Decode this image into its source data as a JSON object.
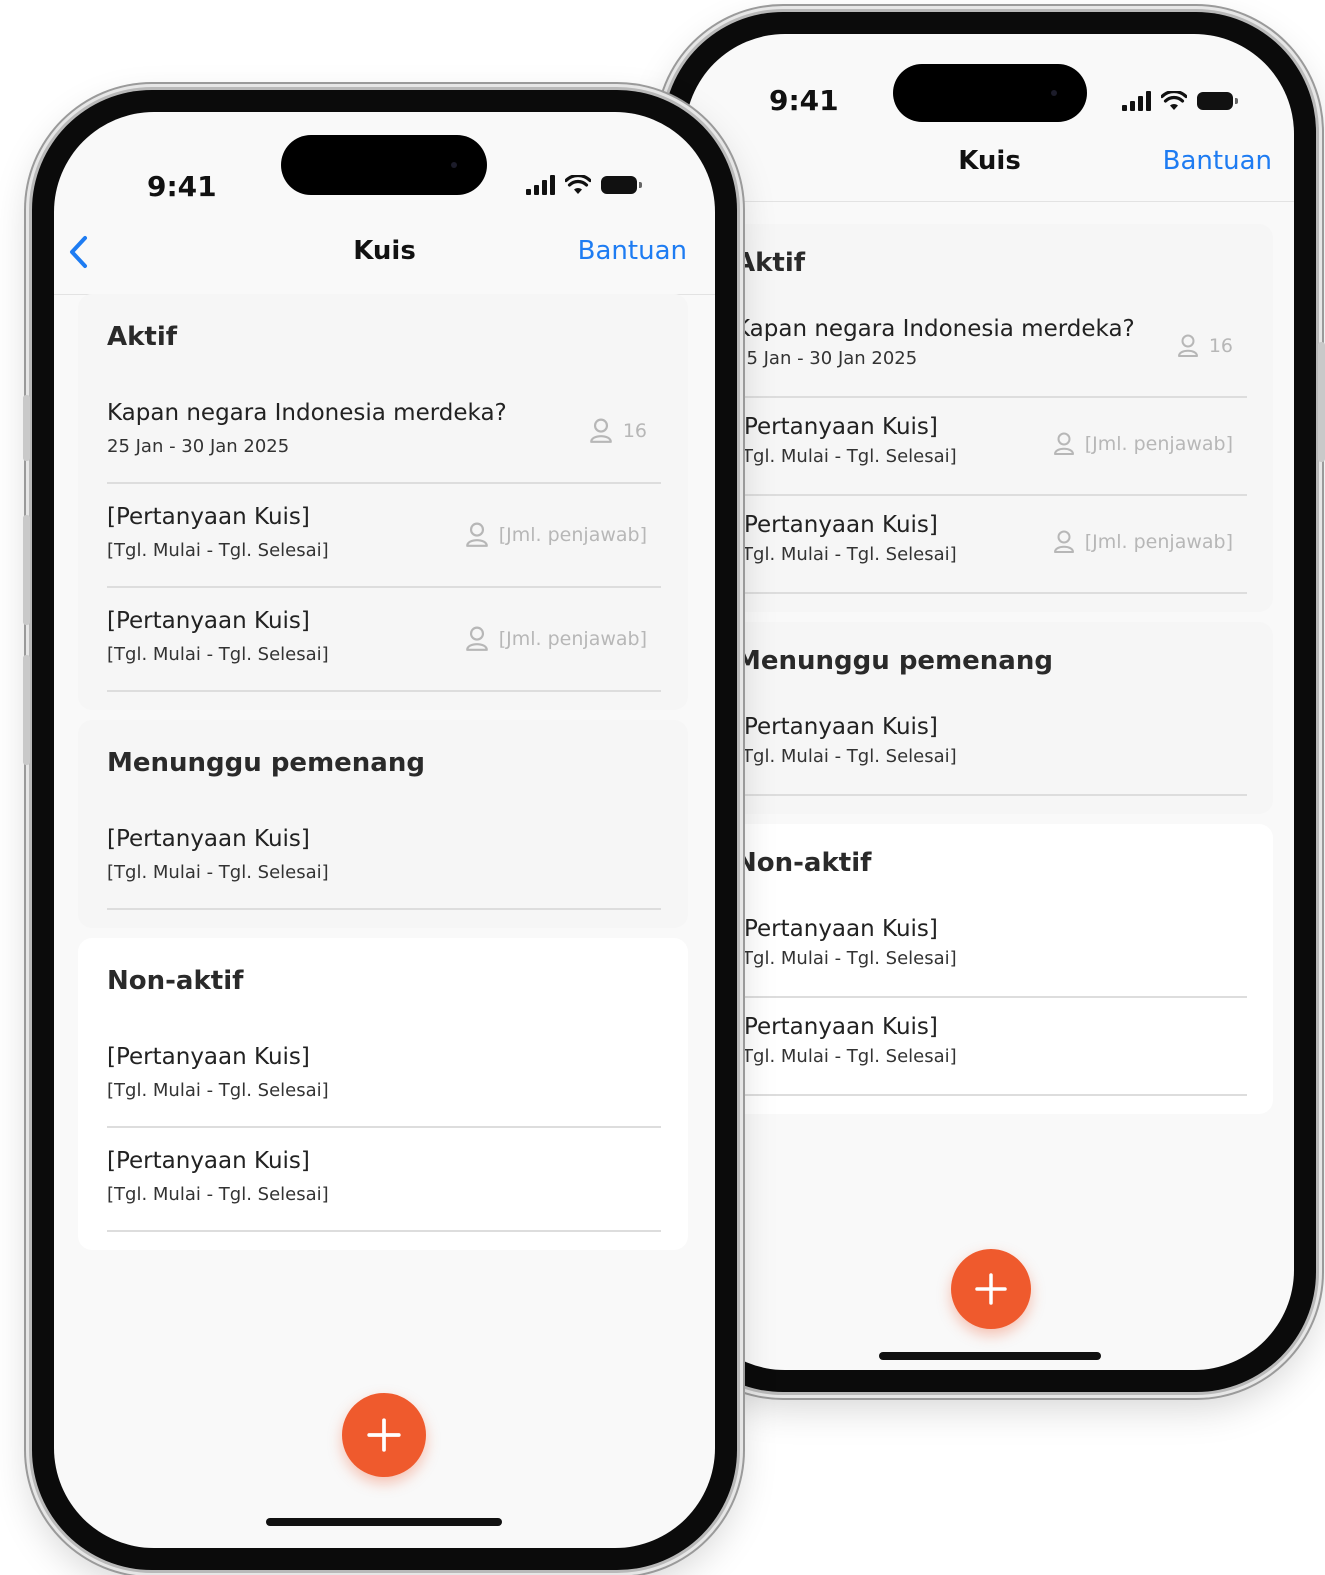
{
  "status_bar": {
    "time": "9:41"
  },
  "navbar": {
    "title": "Kuis",
    "help_label": "Bantuan"
  },
  "sections": {
    "active": {
      "title": "Aktif",
      "items": [
        {
          "question": "Kapan negara Indonesia merdeka?",
          "dates": "25 Jan - 30 Jan 2025",
          "responders": "16"
        },
        {
          "question": "[Pertanyaan Kuis]",
          "dates": "[Tgl. Mulai - Tgl. Selesai]",
          "responders": "[Jml. penjawab]"
        },
        {
          "question": "[Pertanyaan Kuis]",
          "dates": "[Tgl. Mulai - Tgl. Selesai]",
          "responders": "[Jml. penjawab]"
        }
      ]
    },
    "waiting": {
      "title": "Menunggu pemenang",
      "items": [
        {
          "question": "[Pertanyaan Kuis]",
          "dates": "[Tgl. Mulai - Tgl. Selesai]"
        }
      ]
    },
    "inactive": {
      "title": "Non-aktif",
      "items": [
        {
          "question": "[Pertanyaan Kuis]",
          "dates": "[Tgl. Mulai - Tgl. Selesai]"
        },
        {
          "question": "[Pertanyaan Kuis]",
          "dates": "[Tgl. Mulai - Tgl. Selesai]"
        }
      ]
    }
  },
  "colors": {
    "accent": "#ef5a2d",
    "link": "#1e7cf2"
  },
  "icons": {
    "back": "chevron-left-icon",
    "responder": "person-icon",
    "add": "plus-icon"
  }
}
